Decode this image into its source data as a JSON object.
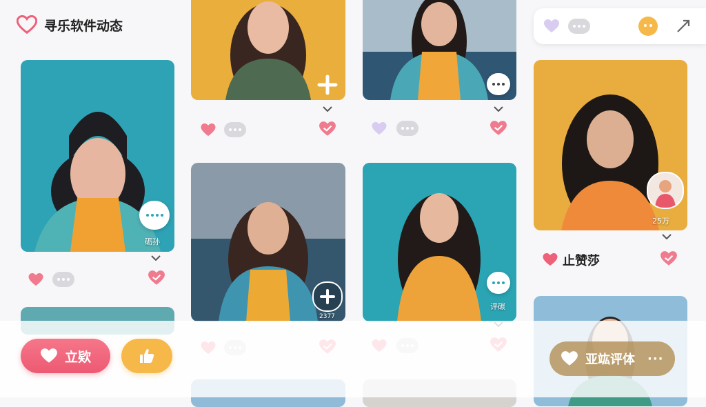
{
  "app": {
    "title": "寻乐软件动态"
  },
  "cards": [
    {
      "caption": "砺孙"
    },
    {
      "caption": ""
    },
    {
      "caption": ""
    },
    {
      "caption": "2377"
    },
    {
      "caption": "评碳"
    },
    {
      "caption": "25万"
    }
  ],
  "profile": {
    "name": "止赞莎"
  },
  "bottom": {
    "like_label": "立欵",
    "comment_label": "亚竑评体",
    "more": "···"
  },
  "colors": {
    "accent": "#ef6079",
    "teal": "#2aa6b6",
    "yellow": "#f7b84a",
    "tan": "#b08c50"
  },
  "icons": [
    "heart-icon",
    "comment-bubble-icon",
    "plus-icon",
    "chevron-down-icon",
    "expand-icon",
    "thumbs-up-icon",
    "more-icon"
  ]
}
